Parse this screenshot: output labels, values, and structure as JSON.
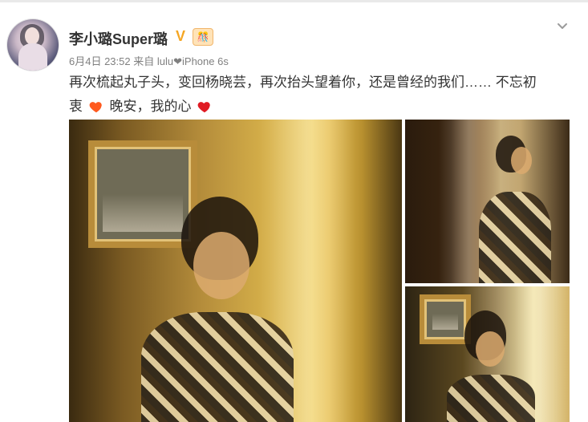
{
  "post": {
    "author": {
      "name": "李小璐Super璐"
    },
    "badges": {
      "verified": "V",
      "vip": "🎊"
    },
    "meta": {
      "date": "6月4日 23:52",
      "source_prefix": "来自",
      "device": "lulu❤iPhone 6s"
    },
    "text": {
      "line1": "再次梳起丸子头，变回杨晓芸，再次抬头望着你，还是曾经的我们…… 不忘初",
      "line2_prefix": "衷",
      "line2_mid": "晚安，我的心"
    }
  },
  "icons": {
    "menu": "chevron-down-icon",
    "heart_orange": "heart-icon",
    "heart_red": "heart-icon"
  },
  "colors": {
    "name": "#333333",
    "meta": "#808080",
    "verified": "#f5a623",
    "heart_orange": "#ff5a1f",
    "heart_red": "#e01b24"
  }
}
